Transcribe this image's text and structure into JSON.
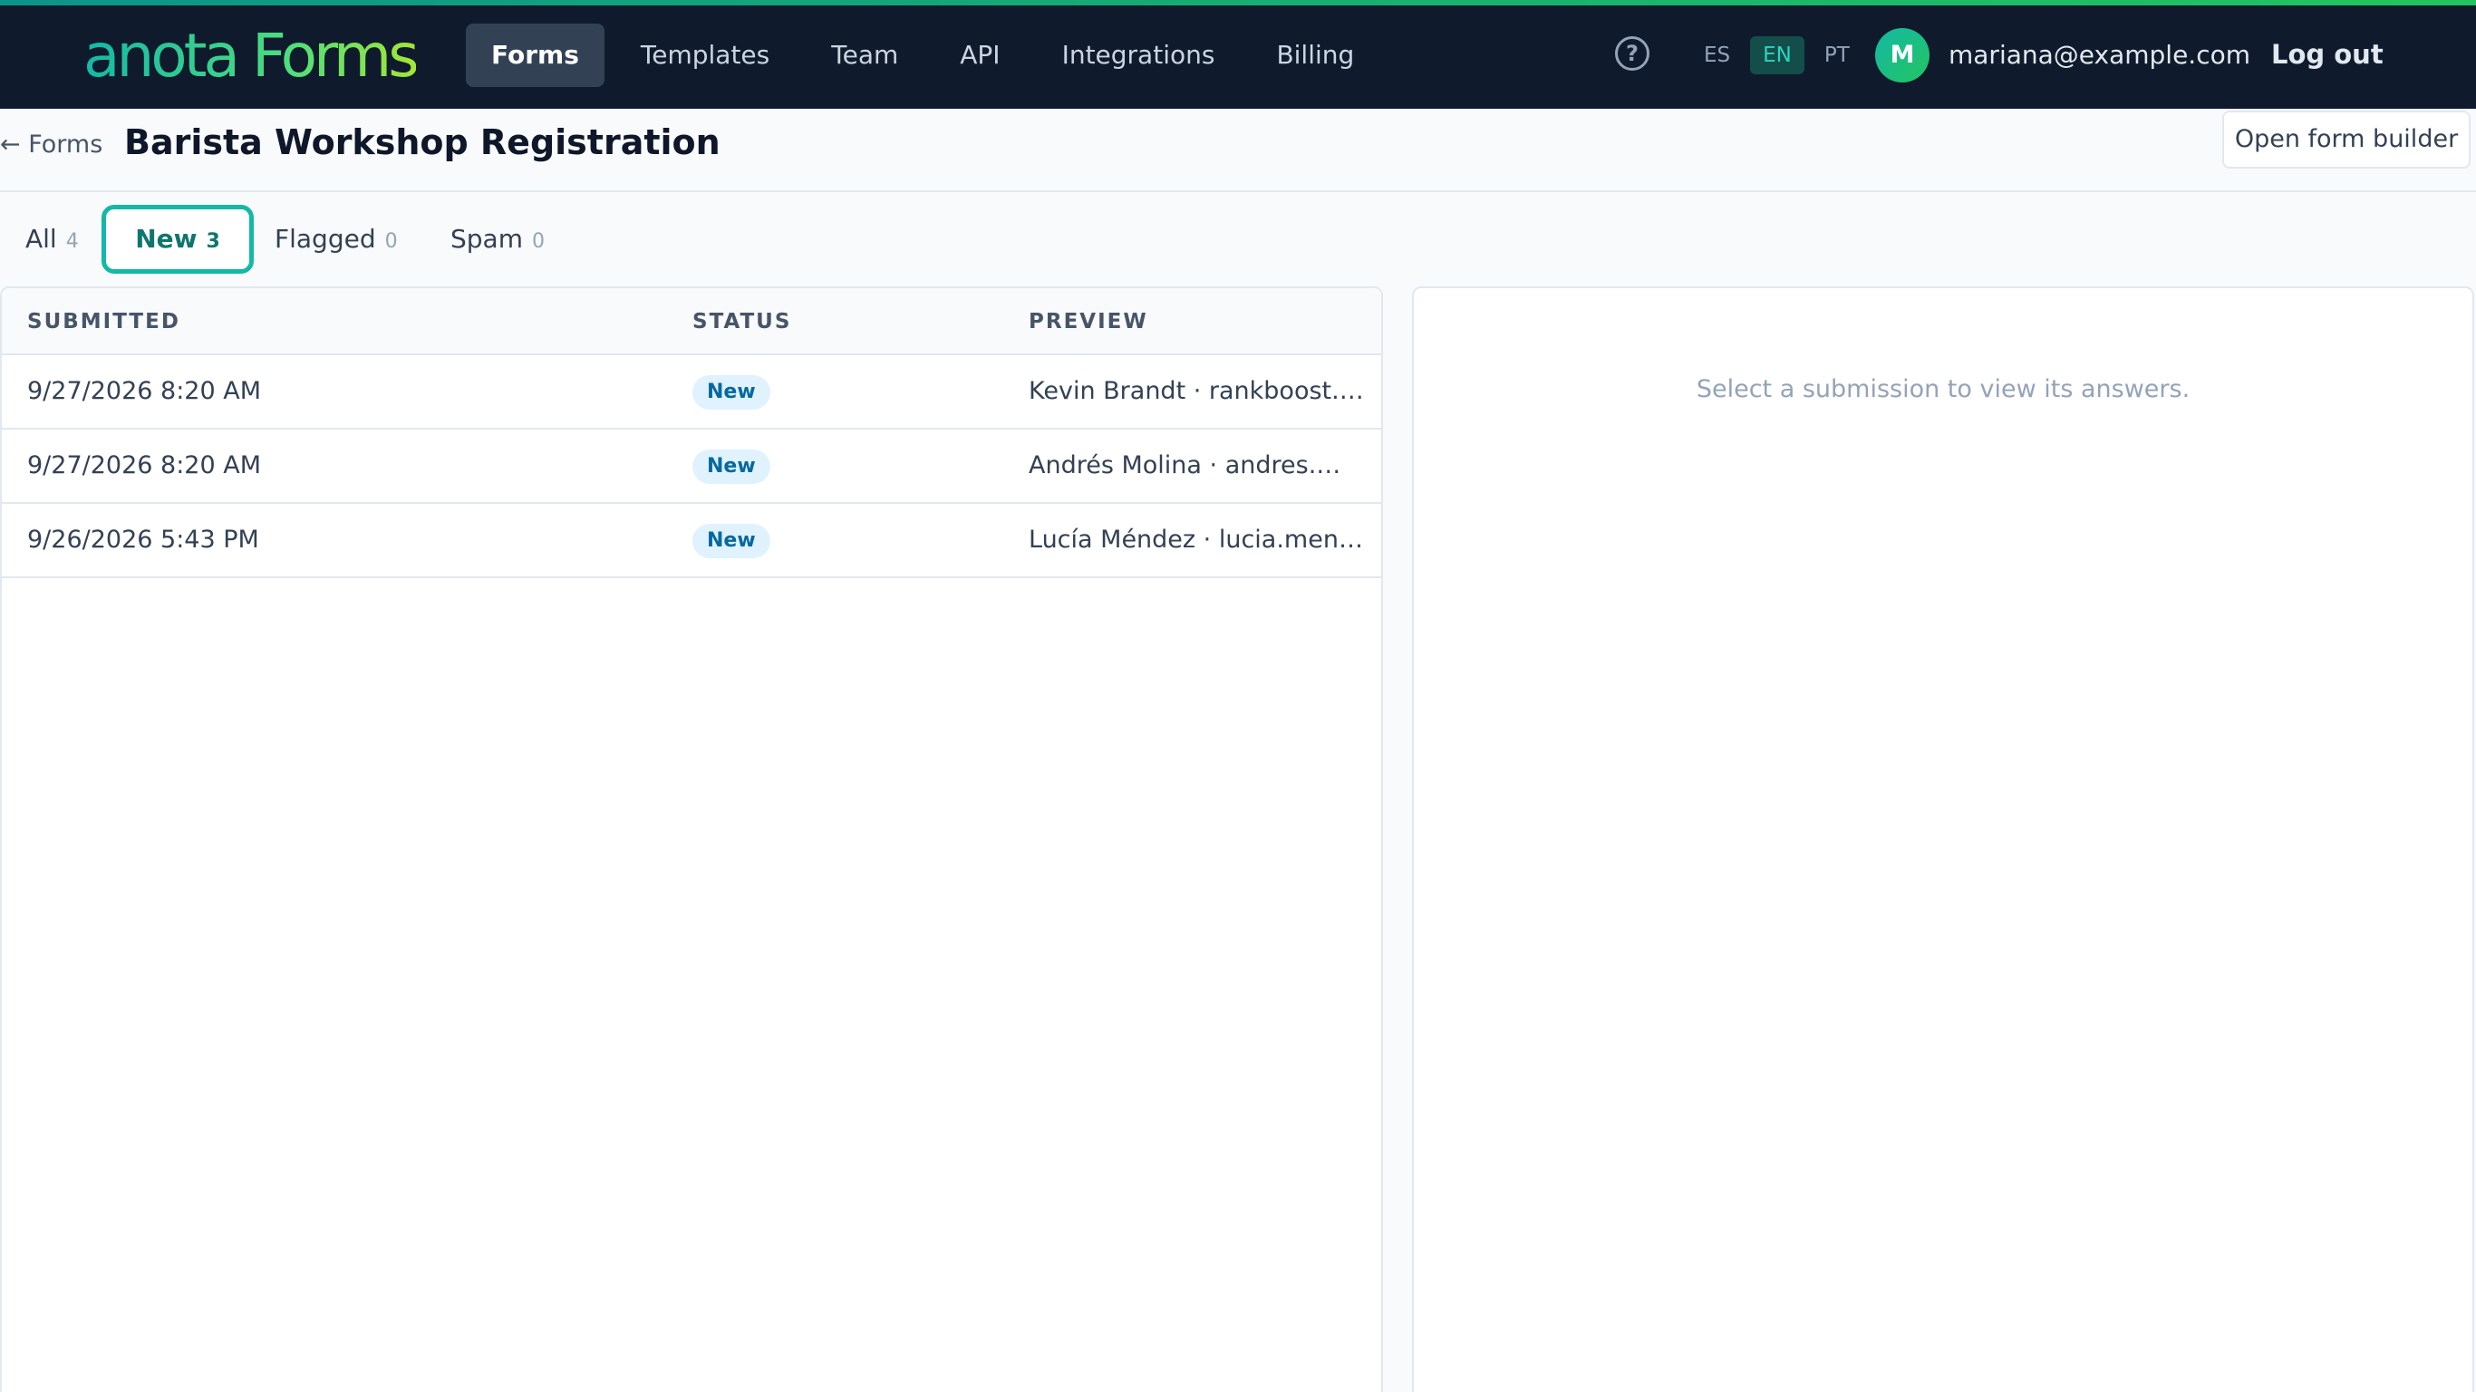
{
  "app": {
    "logo": "anota Forms",
    "nav": [
      "Forms",
      "Templates",
      "Team",
      "API",
      "Integrations",
      "Billing"
    ],
    "active_nav": "Forms",
    "languages": [
      "ES",
      "EN",
      "PT"
    ],
    "active_language": "EN",
    "user": {
      "initial": "M",
      "email": "mariana@example.com"
    },
    "logout_label": "Log out",
    "help_icon": "question-circle-icon"
  },
  "header": {
    "back_label": "← Forms",
    "title": "Barista Workshop Registration",
    "builder_label": "Open form builder"
  },
  "tabs": [
    {
      "label": "All",
      "count": "4"
    },
    {
      "label": "New",
      "count": "3"
    },
    {
      "label": "Flagged",
      "count": "0"
    },
    {
      "label": "Spam",
      "count": "0"
    }
  ],
  "active_tab": "New",
  "table": {
    "columns": [
      "SUBMITTED",
      "STATUS",
      "PREVIEW"
    ],
    "rows": [
      {
        "submitted": "9/27/2026 8:20 AM",
        "status": "New",
        "preview": "Kevin Brandt · rankboost.seo..."
      },
      {
        "submitted": "9/27/2026 8:20 AM",
        "status": "New",
        "preview": "Andrés Molina · andres.moli..."
      },
      {
        "submitted": "9/26/2026 5:43 PM",
        "status": "New",
        "preview": "Lucía Méndez · lucia.mendez..."
      }
    ]
  },
  "detail": {
    "empty_message": "Select a submission to view its answers."
  },
  "colors": {
    "topbar": "#0f1b2d",
    "accent": "#14b8a6",
    "badge_bg": "#e0f2fe",
    "badge_text": "#0369a1"
  }
}
